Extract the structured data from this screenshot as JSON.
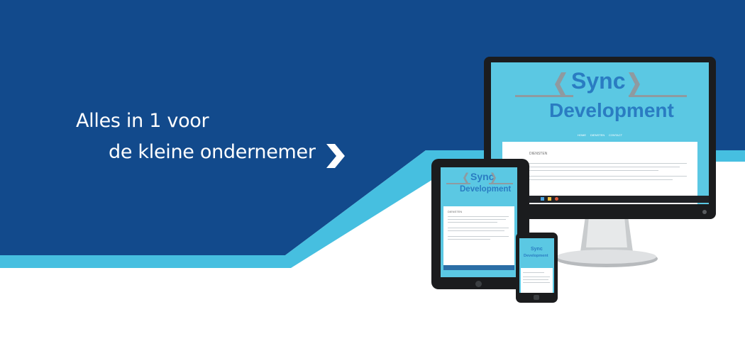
{
  "headline": {
    "line1": "Alles in 1 voor",
    "line2": "de kleine ondernemer"
  },
  "mockup": {
    "logo_top": "Sync",
    "logo_bottom": "Development",
    "nav": [
      "HOME",
      "DIENSTEN",
      "CONTACT"
    ],
    "section_title": "DIENSTEN"
  },
  "colors": {
    "navy": "#124a8c",
    "cyan": "#46bfe0",
    "logo_blue": "#2a7cc2"
  },
  "icons": [
    "chevron-right-icon",
    "chevron-left-icon"
  ]
}
